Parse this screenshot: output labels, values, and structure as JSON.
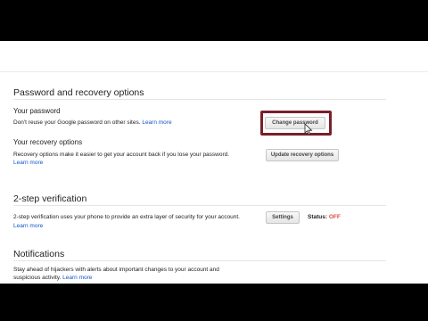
{
  "sections": {
    "password_recovery": {
      "title": "Password and recovery options",
      "your_password": {
        "label": "Your password",
        "description": "Don't reuse your Google password on other sites.",
        "link": "Learn more",
        "button": "Change password"
      },
      "recovery_options": {
        "label": "Your recovery options",
        "description": "Recovery options make it easier to get your account back if you lose your password.",
        "link": "Learn more",
        "button": "Update recovery options"
      }
    },
    "two_step": {
      "title": "2-step verification",
      "description": "2-step verification uses your phone to provide an extra layer of security for your account.",
      "link": "Learn more",
      "button": "Settings",
      "status_label": "Status:",
      "status_value": "OFF"
    },
    "notifications": {
      "title": "Notifications",
      "description_line1": "Stay ahead of hijackers with alerts about important changes to your account and",
      "description_line2": "suspicious activity.",
      "link": "Learn more"
    }
  },
  "colors": {
    "link": "#1155cc",
    "highlight_border": "#7a1f2b",
    "status_off": "#dd4b39"
  }
}
